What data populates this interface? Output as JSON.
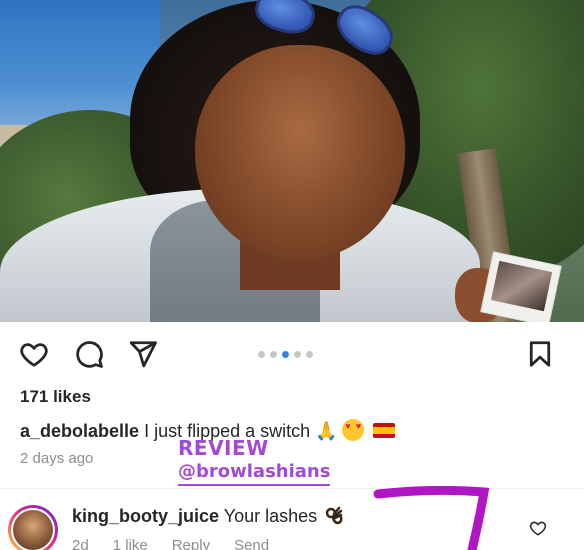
{
  "post": {
    "carousel": {
      "total": 5,
      "active_index": 2
    },
    "likes": "171 likes",
    "caption": {
      "username": "a_debolabelle",
      "text": "I just flipped a switch",
      "emojis": [
        "🙏",
        "😍",
        "🇪🇸"
      ]
    },
    "timestamp": "2 days ago"
  },
  "overlay": {
    "review_label": "REVIEW",
    "review_handle": "@browlashians",
    "color": "#a24ad6"
  },
  "comment": {
    "username": "king_booty_juice",
    "text": "Your lashes",
    "emoji": "👌🏿",
    "age": "2d",
    "likes": "1 like",
    "reply": "Reply",
    "send": "Send"
  },
  "icons": {
    "like": "heart-icon",
    "comment": "comment-bubble-icon",
    "share": "paper-plane-icon",
    "save": "bookmark-icon",
    "comment_like": "small-heart-icon"
  }
}
